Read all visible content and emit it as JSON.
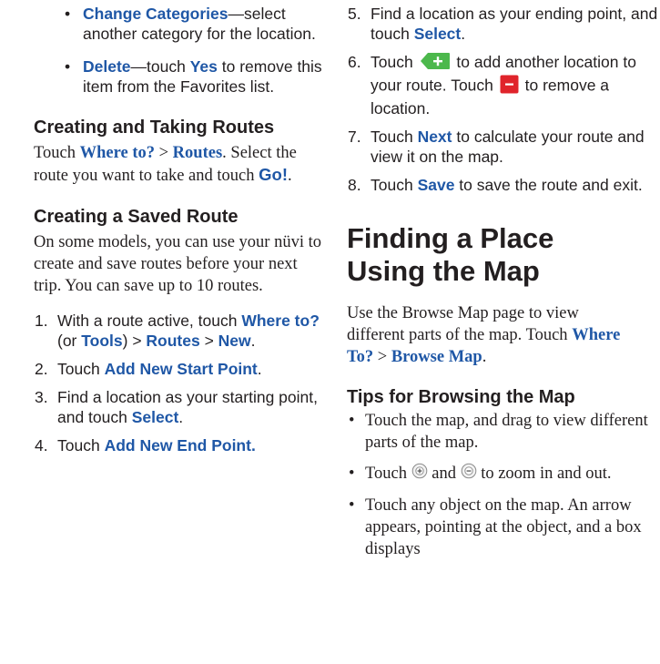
{
  "left": {
    "bullets_top": [
      {
        "link": "Change Categories",
        "text": "—select another category for the location."
      },
      {
        "link": "Delete",
        "t1": "—touch ",
        "yes": "Yes",
        "t2": " to remove this item from the Favorites list."
      }
    ],
    "creating_taking": {
      "heading": "Creating and Taking Routes",
      "p1": "Touch ",
      "where_to": "Where to?",
      "gt": " > ",
      "routes": "Routes",
      "p2": ". Select the route you want to take and touch ",
      "go": "Go!",
      "p3": "."
    },
    "saved_route": {
      "heading": "Creating a Saved Route",
      "para": "On some models, you can use your nüvi to create and save routes before your next trip. You can save up to 10 routes."
    },
    "steps": [
      {
        "n": "1.",
        "a": "With a route active, touch ",
        "where": "Where to?",
        "b": " (or ",
        "tools": "Tools",
        "c": ") > ",
        "routes": "Routes",
        "d": " > ",
        "new": "New",
        "e": "."
      },
      {
        "n": "2.",
        "a": "Touch ",
        "link": "Add New Start Point",
        "b": "."
      },
      {
        "n": "3.",
        "a": "Find a location as your starting point, and touch ",
        "link": "Select",
        "b": "."
      },
      {
        "n": "4.",
        "a": "Touch ",
        "link": "Add New End Point."
      }
    ]
  },
  "right": {
    "steps": [
      {
        "n": "5.",
        "a": "Find a location as your ending point, and touch ",
        "link": "Select",
        "b": "."
      },
      {
        "n": "6.",
        "a": "Touch ",
        "b": " to add another location to your route. Touch ",
        "c": " to remove a location."
      },
      {
        "n": "7.",
        "a": "Touch ",
        "link": "Next",
        "b": " to calculate your route and view it on the map."
      },
      {
        "n": "8.",
        "a": "Touch ",
        "link": "Save",
        "b": " to save the route and exit."
      }
    ],
    "finding": {
      "heading": "Finding a Place Using the Map",
      "p1": "Use the Browse Map page to view different parts of the map. Touch ",
      "where_to": "Where To?",
      "gt": " > ",
      "browse": "Browse Map",
      "p2": "."
    },
    "tips": {
      "heading": "Tips for Browsing the Map",
      "items": [
        {
          "text": "Touch the map, and drag to view different parts of the map."
        },
        {
          "a": "Touch ",
          "b": " and ",
          "c": " to zoom in and out."
        },
        {
          "text": "Touch any object on the map. An arrow appears, pointing at the object, and a box displays"
        }
      ]
    },
    "icons": {
      "add": "add-location-icon",
      "remove": "remove-location-icon",
      "zoom_in": "zoom-in-icon",
      "zoom_out": "zoom-out-icon"
    }
  },
  "colors": {
    "link": "#1f57a6",
    "text": "#231f20",
    "add_green": "#4cb84c",
    "remove_red": "#e0242b"
  }
}
